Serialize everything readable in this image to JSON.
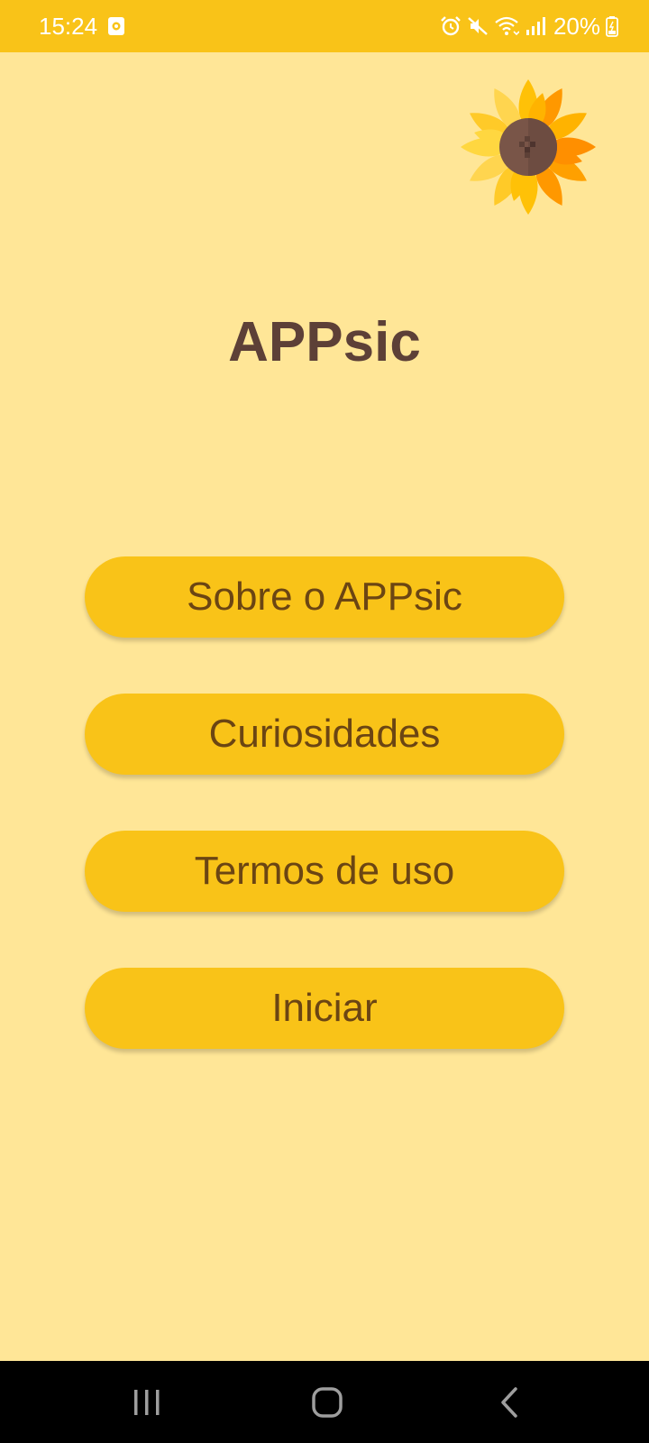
{
  "status_bar": {
    "time": "15:24",
    "battery_percent": "20%",
    "icons": [
      "notification-icon",
      "alarm-icon",
      "mute-icon",
      "wifi-icon",
      "signal-icon",
      "battery-icon"
    ]
  },
  "app": {
    "title": "APPsic",
    "logo": "sunflower-icon"
  },
  "menu": {
    "items": [
      {
        "label": "Sobre o APPsic"
      },
      {
        "label": "Curiosidades"
      },
      {
        "label": "Termos de uso"
      },
      {
        "label": "Iniciar"
      }
    ]
  },
  "nav_bar": {
    "icons": [
      "recent-apps-icon",
      "home-icon",
      "back-icon"
    ]
  },
  "colors": {
    "background": "#FFE697",
    "status_bar": "#F9C318",
    "button": "#F9C318",
    "title_text": "#5D4037",
    "button_text": "#6B4513"
  }
}
